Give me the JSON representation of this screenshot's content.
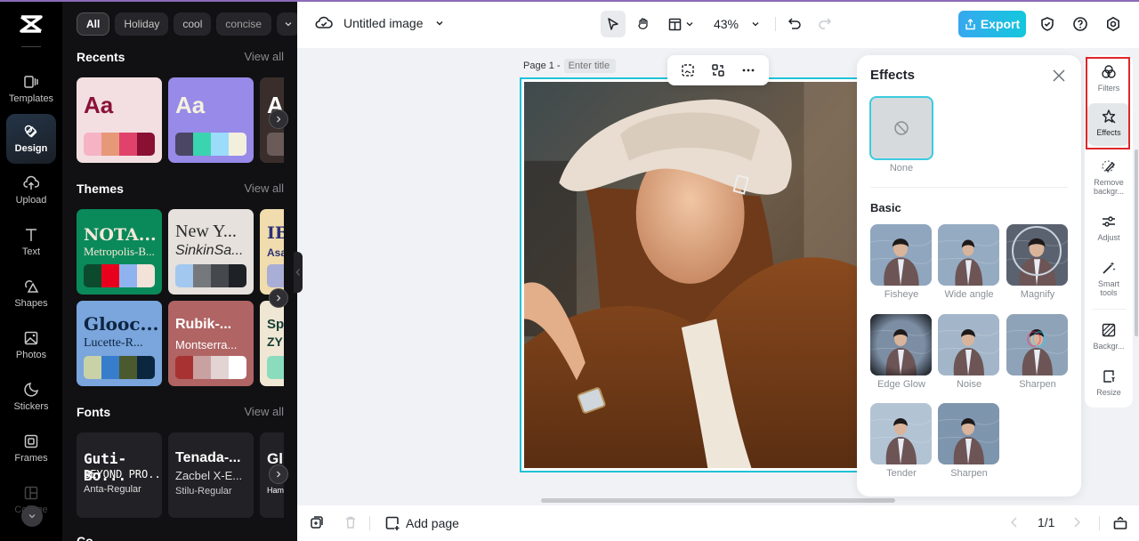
{
  "app": {
    "document_title": "Untitled image",
    "accent_color": "#1fc3d6"
  },
  "rail": {
    "items": [
      {
        "label": "Templates",
        "icon": "templates-icon"
      },
      {
        "label": "Design",
        "icon": "design-icon",
        "active": true
      },
      {
        "label": "Upload",
        "icon": "upload-icon"
      },
      {
        "label": "Text",
        "icon": "text-icon"
      },
      {
        "label": "Shapes",
        "icon": "shapes-icon"
      },
      {
        "label": "Photos",
        "icon": "photos-icon"
      },
      {
        "label": "Stickers",
        "icon": "stickers-icon"
      },
      {
        "label": "Frames",
        "icon": "frames-icon"
      },
      {
        "label": "Collage",
        "icon": "collage-icon"
      }
    ]
  },
  "design_panel": {
    "chips": [
      "All",
      "Holiday",
      "cool",
      "concise"
    ],
    "recents": {
      "title": "Recents",
      "view_all": "View all",
      "cards": [
        {
          "text": "Aa",
          "bg": "#f3dfe2",
          "fg": "#8a1238",
          "swatches": [
            "#f5b3c3",
            "#e69878",
            "#e0426c",
            "#8a1033"
          ]
        },
        {
          "text": "Aa",
          "bg": "#978ae8",
          "fg": "#f5f1de",
          "swatches": [
            "#4a4663",
            "#3bd4b0",
            "#9bdcfb",
            "#f3efdd"
          ]
        },
        {
          "text": "A",
          "bg": "#3a2e2c",
          "fg": "#ffffff",
          "swatches": [
            "#6a5b58"
          ]
        }
      ]
    },
    "themes": {
      "title": "Themes",
      "view_all": "View all",
      "cards": [
        {
          "title": "NOTA...",
          "sub": "Metropolis-B...",
          "bg": "#0a8a5a",
          "fg": "#f6e8da",
          "swatches": [
            "#0c4a2e",
            "#e8001c",
            "#8fb3ee",
            "#f3e2d8"
          ]
        },
        {
          "title": "New Y...",
          "sub": "SinkinSa...",
          "bg": "#e6e1dc",
          "fg": "#2a2a2a",
          "swatches": [
            "#a3c8ef",
            "#76797c",
            "#45484d",
            "#1e2126"
          ]
        },
        {
          "title": "IB",
          "sub": "Asa",
          "bg": "#f1dcae",
          "fg": "#2c3277",
          "swatches": [
            "#a9aed6"
          ]
        },
        {
          "title": "Glooc...",
          "sub": "Lucette-R...",
          "bg": "#7aa5dd",
          "fg": "#0e2541",
          "swatches": [
            "#c9d1a6",
            "#387ccc",
            "#4a5a2e",
            "#0b2740"
          ]
        },
        {
          "title": "Rubik-...",
          "sub": "Montserra...",
          "bg": "#b06464",
          "fg": "#ffffff",
          "swatches": [
            "#a83232",
            "#caa1a1",
            "#e3d4d4",
            "#ffffff"
          ]
        },
        {
          "title": "Sp",
          "sub": "ZY",
          "bg": "#efe7d4",
          "fg": "#153f35",
          "swatches": [
            "#8bdcbf"
          ]
        }
      ]
    },
    "fonts": {
      "title": "Fonts",
      "view_all": "View all",
      "cards": [
        {
          "line1": "Guti-Bo...",
          "line2": "BEYOND PRO...",
          "line3": "Anta-Regular"
        },
        {
          "line1": "Tenada-...",
          "line2": "Zacbel X-E...",
          "line3": "Stilu-Regular"
        },
        {
          "line1": "Gl",
          "line2": "",
          "line3": "Ham"
        }
      ]
    },
    "next_section_partial": "Co"
  },
  "topbar": {
    "zoom_level": "43%",
    "export_label": "Export"
  },
  "canvas": {
    "page_label": "Page 1 -",
    "page_title_placeholder": "Enter title"
  },
  "effects_panel": {
    "title": "Effects",
    "none_label": "None",
    "section_title": "Basic",
    "effects": [
      {
        "label": "Fisheye"
      },
      {
        "label": "Wide angle"
      },
      {
        "label": "Magnify"
      },
      {
        "label": "Edge Glow"
      },
      {
        "label": "Noise"
      },
      {
        "label": "Sharpen"
      },
      {
        "label": "Tender"
      },
      {
        "label": "Sharpen"
      }
    ]
  },
  "right_tools": [
    {
      "label": "Filters",
      "icon": "filters-icon"
    },
    {
      "label": "Effects",
      "icon": "effects-icon",
      "active": true
    },
    {
      "label": "Remove backgr...",
      "icon": "remove-background-icon"
    },
    {
      "label": "Adjust",
      "icon": "adjust-icon"
    },
    {
      "label": "Smart tools",
      "icon": "smart-tools-icon"
    },
    {
      "label": "Backgr...",
      "icon": "background-icon"
    },
    {
      "label": "Resize",
      "icon": "resize-icon"
    }
  ],
  "bottombar": {
    "add_page_label": "Add page",
    "page_counter": "1/1"
  }
}
